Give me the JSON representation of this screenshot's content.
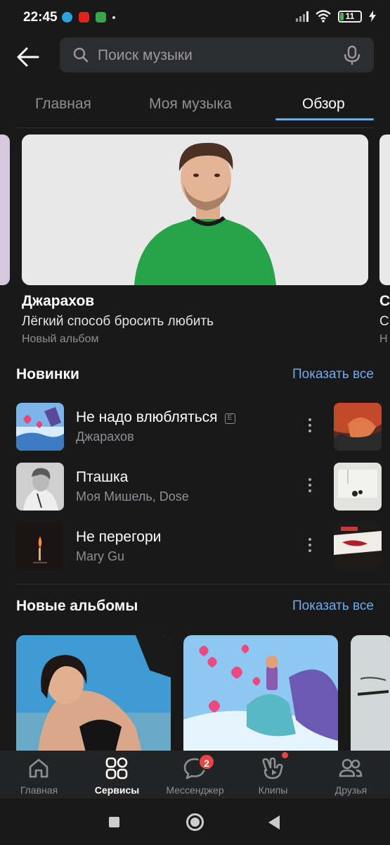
{
  "status_bar": {
    "time": "22:45",
    "battery": "11",
    "notification_icons": [
      "telegram-icon",
      "youtube-icon",
      "app-icon",
      "dot-icon"
    ]
  },
  "search": {
    "placeholder": "Поиск музыки"
  },
  "tabs": [
    {
      "label": "Главная",
      "active": false
    },
    {
      "label": "Моя музыка",
      "active": false
    },
    {
      "label": "Обзор",
      "active": true
    }
  ],
  "featured": {
    "title": "Джарахов",
    "subtitle": "Лёгкий способ бросить любить",
    "type": "Новый альбом",
    "peek_title": "С",
    "peek_subtitle": "С",
    "peek_type": "Н"
  },
  "new_releases": {
    "title": "Новинки",
    "show_all": "Показать все",
    "tracks": [
      {
        "title": "Не надо влюбляться",
        "artist": "Джарахов",
        "explicit": "E"
      },
      {
        "title": "Пташка",
        "artist": "Моя Мишель, Dose"
      },
      {
        "title": "Не перегори",
        "artist": "Mary Gu"
      }
    ]
  },
  "new_albums": {
    "title": "Новые альбомы",
    "show_all": "Показать все"
  },
  "bottom_nav": [
    {
      "label": "Главная",
      "icon": "home-icon"
    },
    {
      "label": "Сервисы",
      "icon": "services-icon",
      "active": true
    },
    {
      "label": "Мессенджер",
      "icon": "messenger-icon",
      "badge": "2"
    },
    {
      "label": "Клипы",
      "icon": "clips-icon",
      "dot": true
    },
    {
      "label": "Друзья",
      "icon": "friends-icon"
    }
  ],
  "colors": {
    "accent": "#71aaeb",
    "badge": "#e64646",
    "background": "#19191a"
  }
}
